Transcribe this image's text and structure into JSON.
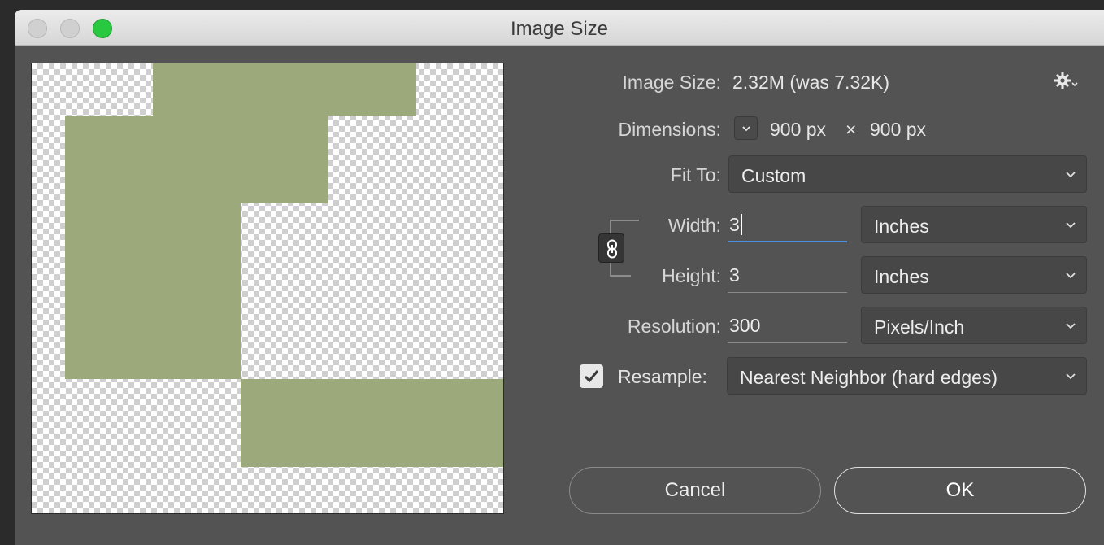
{
  "window": {
    "title": "Image Size"
  },
  "image_size": {
    "label": "Image Size:",
    "value": "2.32M (was 7.32K)"
  },
  "dimensions": {
    "label": "Dimensions:",
    "width": "900 px",
    "times": "×",
    "height": "900 px"
  },
  "fit_to": {
    "label": "Fit To:",
    "value": "Custom"
  },
  "width": {
    "label": "Width:",
    "value": "3",
    "unit": "Inches"
  },
  "height": {
    "label": "Height:",
    "value": "3",
    "unit": "Inches"
  },
  "resolution": {
    "label": "Resolution:",
    "value": "300",
    "unit": "Pixels/Inch"
  },
  "resample": {
    "label": "Resample:",
    "checked": true,
    "method": "Nearest Neighbor (hard edges)"
  },
  "buttons": {
    "cancel": "Cancel",
    "ok": "OK"
  },
  "icons": {
    "settings": "gear-icon",
    "dimensions_menu": "chevron-down-icon",
    "constrain": "chain-link-icon",
    "checkbox": "checkmark-icon"
  },
  "colors": {
    "dialog_bg": "#535353",
    "preview_fill": "#9caa7b",
    "accent": "#4a90e2",
    "close_zoom_green": "#28c840"
  }
}
